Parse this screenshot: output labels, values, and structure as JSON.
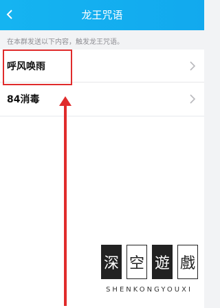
{
  "header": {
    "title": "龙王咒语"
  },
  "hint": "在本群发送以下内容，触发龙王咒语。",
  "items": [
    {
      "label": "呼风唤雨"
    },
    {
      "label": "84消毒"
    }
  ],
  "colors": {
    "header": "#15b4f1",
    "highlight": "#e02b2b"
  },
  "watermark": {
    "chars": [
      "深",
      "空",
      "遊",
      "戲"
    ],
    "text": "SHENKONGYOUXI"
  }
}
